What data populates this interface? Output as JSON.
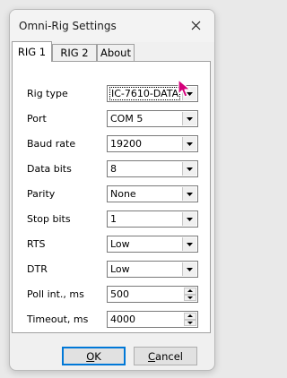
{
  "window": {
    "title": "Omni-Rig Settings"
  },
  "tabs": [
    {
      "label": "RIG 1",
      "active": true
    },
    {
      "label": "RIG 2",
      "active": false
    },
    {
      "label": "About",
      "active": false
    }
  ],
  "fields": {
    "rig_type": {
      "label": "Rig type",
      "value": "IC-7610-DATA"
    },
    "port": {
      "label": "Port",
      "value": "COM 5"
    },
    "baud_rate": {
      "label": "Baud rate",
      "value": "19200"
    },
    "data_bits": {
      "label": "Data bits",
      "value": "8"
    },
    "parity": {
      "label": "Parity",
      "value": "None"
    },
    "stop_bits": {
      "label": "Stop bits",
      "value": "1"
    },
    "rts": {
      "label": "RTS",
      "value": "Low"
    },
    "dtr": {
      "label": "DTR",
      "value": "Low"
    },
    "poll_int": {
      "label": "Poll int., ms",
      "value": "500"
    },
    "timeout": {
      "label": "Timeout, ms",
      "value": "4000"
    }
  },
  "buttons": {
    "ok": {
      "label_underlined": "O",
      "label_rest": "K"
    },
    "cancel": {
      "label_underlined": "C",
      "label_rest": "ancel"
    }
  },
  "colors": {
    "focus_border": "#0078d7",
    "cursor": "#d4007a"
  },
  "icons": {
    "close": "close-icon",
    "dropdown": "chevron-down-icon",
    "spin_up": "spin-up-icon",
    "spin_down": "spin-down-icon",
    "cursor": "mouse-cursor-icon"
  }
}
